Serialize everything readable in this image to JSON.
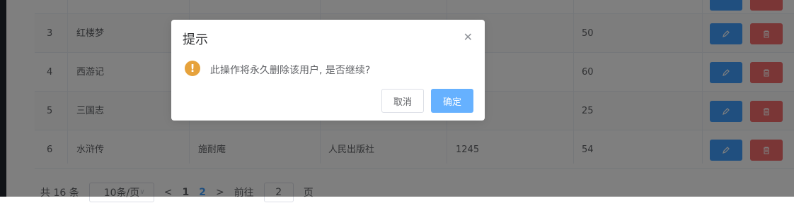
{
  "table": {
    "rows": [
      {
        "id": "3",
        "name": "红楼梦",
        "author": "",
        "publisher": "",
        "pages": "",
        "price": "50"
      },
      {
        "id": "4",
        "name": "西游记",
        "author": "",
        "publisher": "",
        "pages": "",
        "price": "60"
      },
      {
        "id": "5",
        "name": "三国志",
        "author": "",
        "publisher": "",
        "pages": "",
        "price": "25"
      },
      {
        "id": "6",
        "name": "水浒传",
        "author": "施耐庵",
        "publisher": "人民出版社",
        "pages": "1245",
        "price": "54"
      }
    ]
  },
  "pagination": {
    "total": "共 16 条",
    "page_size": "10条/页",
    "prev": "<",
    "pages": [
      "1",
      "2"
    ],
    "next": ">",
    "goto_label": "前往",
    "goto_value": "2",
    "page_unit": "页"
  },
  "dialog": {
    "title": "提示",
    "message": "此操作将永久删除该用户, 是否继续?",
    "cancel_label": "取消",
    "confirm_label": "确定",
    "warning_glyph": "!"
  },
  "colors": {
    "primary": "#409eff",
    "danger": "#f56c6c",
    "warning": "#e6a23c",
    "confirm_light": "#66b1ff"
  },
  "icons": {
    "edit": "edit-icon",
    "delete": "delete-icon",
    "close": "close-icon",
    "warning": "warning-icon"
  }
}
